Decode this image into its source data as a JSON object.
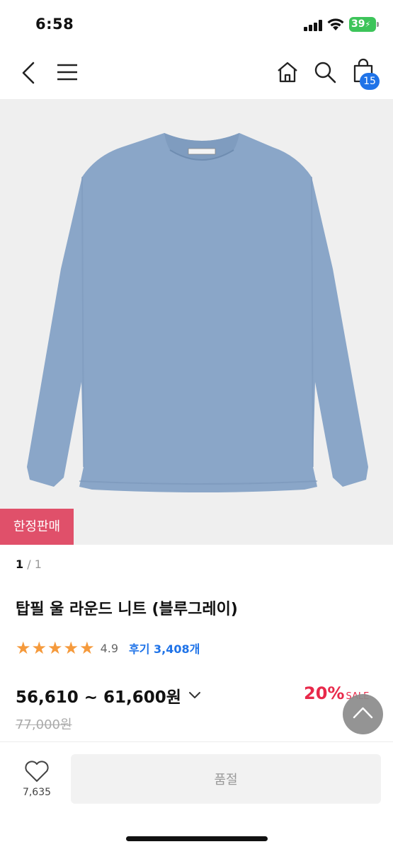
{
  "status_bar": {
    "time": "6:58",
    "battery": "39"
  },
  "header": {
    "back_icon": "chevron-left-icon",
    "menu_icon": "hamburger-menu-icon",
    "home_icon": "home-icon",
    "search_icon": "search-icon",
    "cart_icon": "shopping-bag-icon",
    "cart_count": "15"
  },
  "product": {
    "badge": "한정판매",
    "image_pager": {
      "current": "1",
      "separator": " / ",
      "total": "1"
    },
    "title": "탑필 울 라운드 니트 (블루그레이)",
    "rating": {
      "stars": 5,
      "value": "4.9",
      "review_label": "후기 3,408개"
    },
    "price_range": "56,610 ~ 61,600원",
    "discount": {
      "percent": "20%",
      "label": "SALE"
    },
    "original_price": "77,000원"
  },
  "bottom_bar": {
    "wishlist_count": "7,635",
    "soldout_label": "품절"
  },
  "colors": {
    "accent_blue": "#1f73e8",
    "sale_red": "#e8294a",
    "badge_pink": "#e0506a",
    "star_orange": "#f59a3c",
    "sweater": "#8aa6c8"
  }
}
